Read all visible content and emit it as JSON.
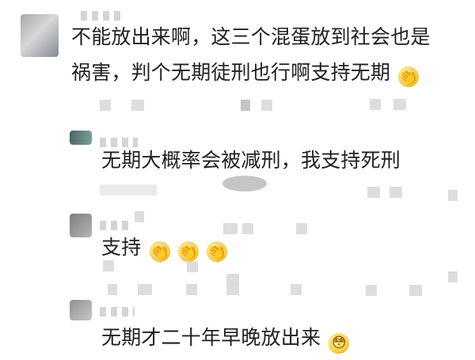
{
  "comments": [
    {
      "lines": [
        "不能放出来啊，这三个混蛋放到社会也是",
        "祸害，判个无期徒刑也行啊支持无期"
      ],
      "emoji": "clapping-hands-emoji"
    },
    {
      "text": "无期大概率会被减刑，我支持死刑"
    },
    {
      "text": "支持",
      "emoji": [
        "clapping-hands-emoji",
        "clapping-hands-emoji",
        "clapping-hands-emoji"
      ]
    },
    {
      "text": "无期才二十年早晚放出来",
      "emoji": "flushed-face-emoji"
    }
  ]
}
